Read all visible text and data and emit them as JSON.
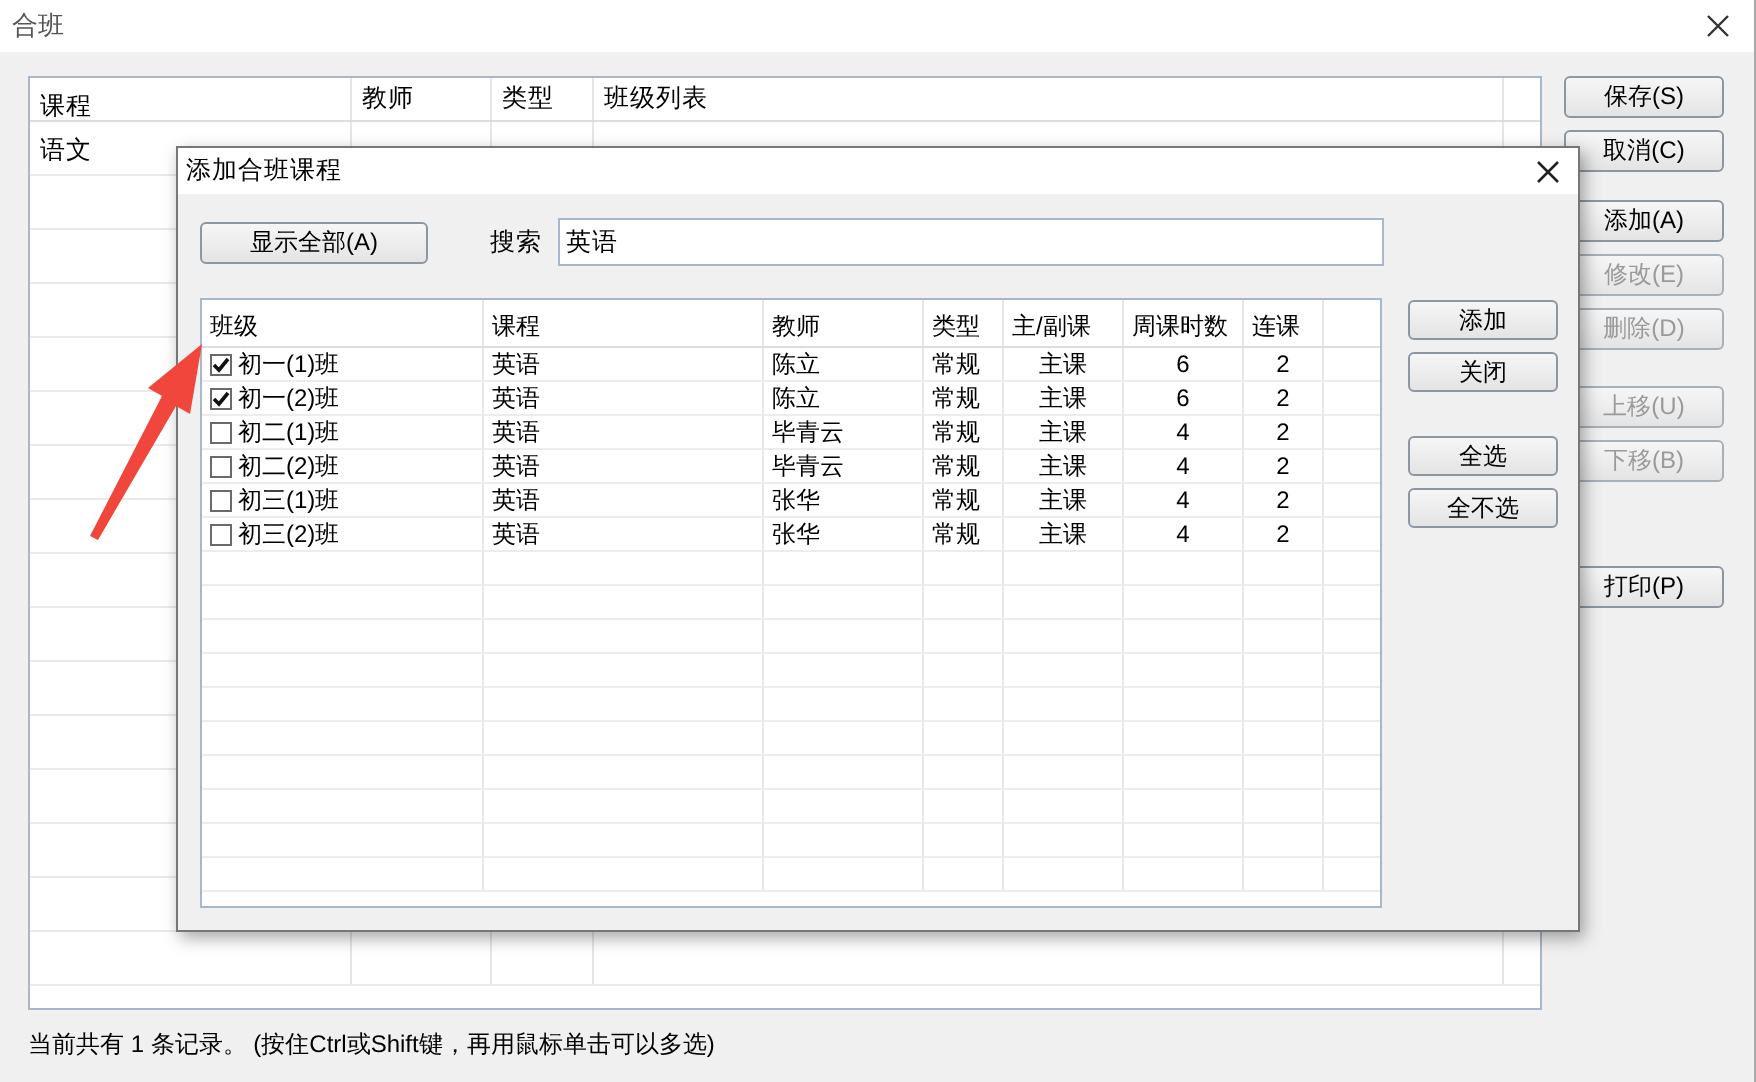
{
  "window": {
    "title": "合班"
  },
  "main_table": {
    "columns": [
      "课程",
      "教师",
      "类型",
      "班级列表"
    ],
    "rows": [
      {
        "cells": [
          "语文"
        ]
      }
    ]
  },
  "side_button_groups": [
    [
      {
        "label": "保存(S)",
        "disabled": false
      },
      {
        "label": "取消(C)",
        "disabled": false
      }
    ],
    [
      {
        "label": "添加(A)",
        "disabled": false
      },
      {
        "label": "修改(E)",
        "disabled": true
      },
      {
        "label": "删除(D)",
        "disabled": true
      }
    ],
    [
      {
        "label": "上移(U)",
        "disabled": true
      },
      {
        "label": "下移(B)",
        "disabled": true
      }
    ],
    [
      {
        "label": "打印(P)",
        "disabled": false
      }
    ]
  ],
  "status_text": "当前共有 1 条记录。 (按住Ctrl或Shift键，再用鼠标单击可以多选)",
  "dialog": {
    "title": "添加合班课程",
    "show_all_button": "显示全部(A)",
    "search": {
      "label": "搜索",
      "value": "英语"
    },
    "grid": {
      "columns": [
        "班级",
        "课程",
        "教师",
        "类型",
        "主/副课",
        "周课时数",
        "连课"
      ],
      "rows": [
        {
          "checked": true,
          "cells": [
            "初一(1)班",
            "英语",
            "陈立",
            "常规",
            "主课",
            "6",
            "2"
          ]
        },
        {
          "checked": true,
          "cells": [
            "初一(2)班",
            "英语",
            "陈立",
            "常规",
            "主课",
            "6",
            "2"
          ]
        },
        {
          "checked": false,
          "cells": [
            "初二(1)班",
            "英语",
            "毕青云",
            "常规",
            "主课",
            "4",
            "2"
          ]
        },
        {
          "checked": false,
          "cells": [
            "初二(2)班",
            "英语",
            "毕青云",
            "常规",
            "主课",
            "4",
            "2"
          ]
        },
        {
          "checked": false,
          "cells": [
            "初三(1)班",
            "英语",
            "张华",
            "常规",
            "主课",
            "4",
            "2"
          ]
        },
        {
          "checked": false,
          "cells": [
            "初三(2)班",
            "英语",
            "张华",
            "常规",
            "主课",
            "4",
            "2"
          ]
        }
      ]
    },
    "button_groups": [
      [
        "添加",
        "关闭"
      ],
      [
        "全选",
        "全不选"
      ]
    ]
  }
}
